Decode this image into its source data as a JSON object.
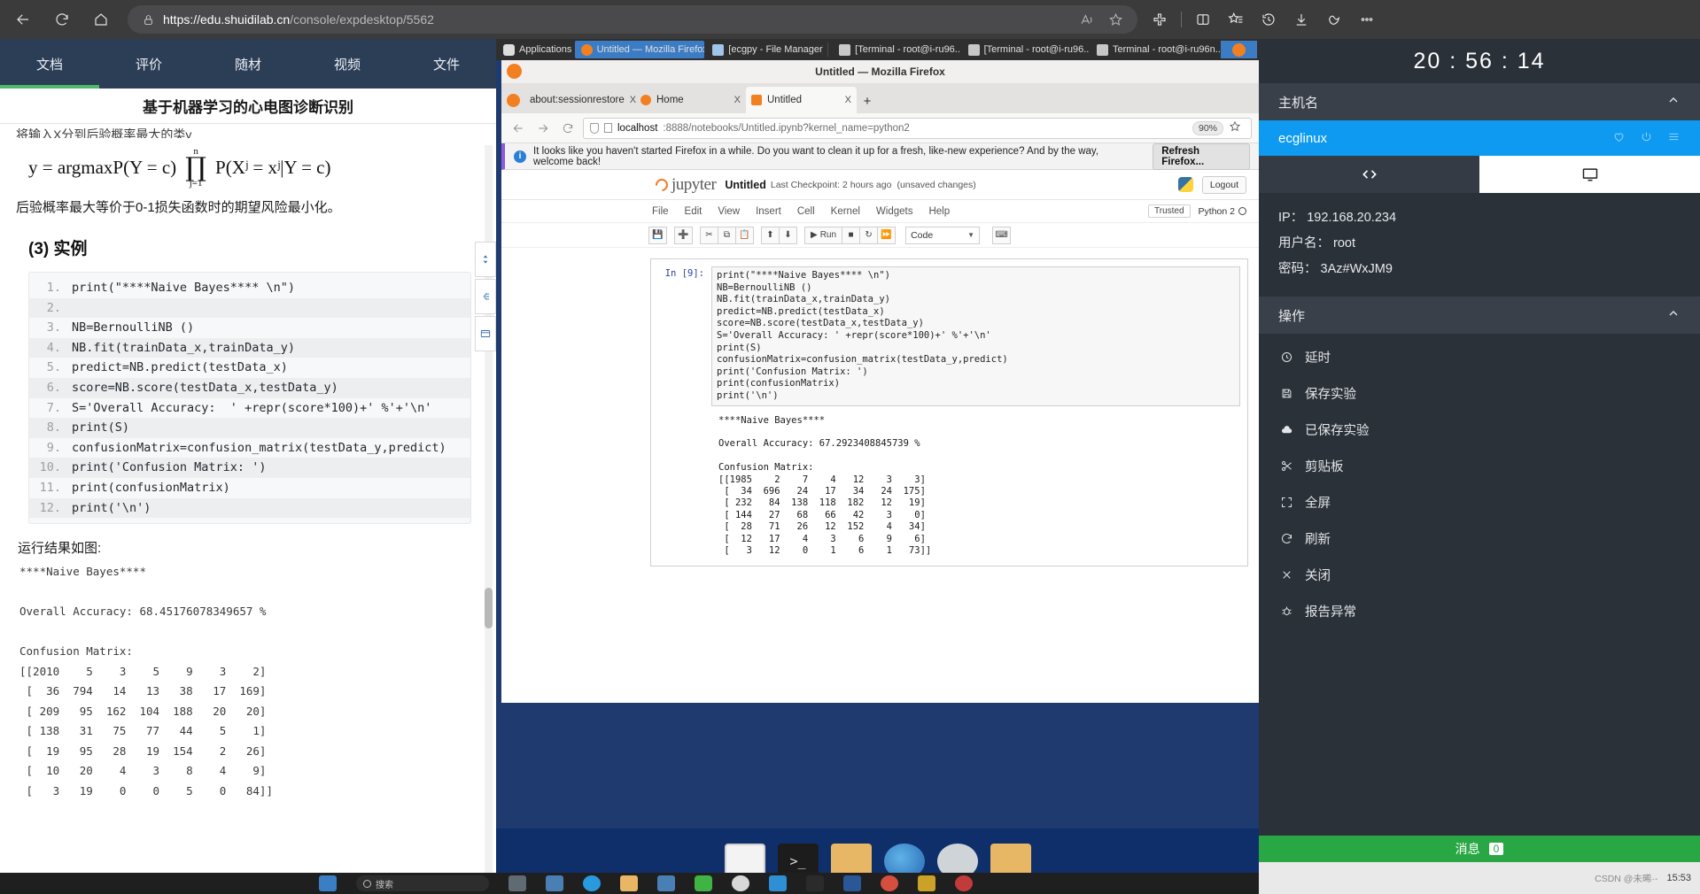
{
  "browser": {
    "url_host": "https://edu.shuidilab.cn",
    "url_path": "/console/expdesktop/5562",
    "nav": {
      "back": "back-arrow",
      "reload": "reload",
      "home": "home"
    },
    "actions": [
      "read-aloud",
      "favorite",
      "extensions",
      "split-screen",
      "collections",
      "history",
      "downloads",
      "copilot",
      "settings-more"
    ]
  },
  "course": {
    "tabs": [
      {
        "label": "文档",
        "active": true
      },
      {
        "label": "评价",
        "active": false
      },
      {
        "label": "随材",
        "active": false
      },
      {
        "label": "视频",
        "active": false
      },
      {
        "label": "文件",
        "active": false
      }
    ],
    "title": "基于机器学习的心电图诊断识别",
    "clipped_line": "将输入X分到后验概率最大的类y",
    "formula": {
      "lhs": "y =  argmaxP(Y = c)",
      "prod_top": "n",
      "prod_bottom": "j=1",
      "rhs": "P(Xʲ = xʲ|Y = c)"
    },
    "sentence": "后验概率最大等价于0-1损失函数时的期望风险最小化。",
    "example_heading": "(3) 实例",
    "code_lines": [
      "print(\"****Naive Bayes**** \\n\")",
      "",
      "NB=BernoulliNB ()",
      "NB.fit(trainData_x,trainData_y)",
      "predict=NB.predict(testData_x)",
      "score=NB.score(testData_x,testData_y)",
      "S='Overall Accuracy:  ' +repr(score*100)+' %'+'\\n'",
      "print(S)",
      "confusionMatrix=confusion_matrix(testData_y,predict)",
      "print('Confusion Matrix: ')",
      "print(confusionMatrix)",
      "print('\\n')"
    ],
    "run_label": "运行结果如图:",
    "output_text": "****Naive Bayes****\n\nOverall Accuracy: 68.45176078349657 %\n\nConfusion Matrix:\n[[2010    5    3    5    9    3    2]\n [  36  794   14   13   38   17  169]\n [ 209   95  162  104  188   20   20]\n [ 138   31   75   77   44    5    1]\n [  19   95   28   19  154    2   26]\n [  10   20    4    3    8    4    9]\n [   3   19    0    0    5    0   84]]"
  },
  "vnc": {
    "taskbar": {
      "applications": "Applications",
      "windows": [
        {
          "label": "Untitled — Mozilla Firefox",
          "icon": "firefox-icon",
          "active": true
        },
        {
          "label": "[ecgpy - File Manager]",
          "icon": "filemanager-icon",
          "active": false
        },
        {
          "label": "[Terminal - root@i-ru96...",
          "icon": "terminal-icon",
          "active": false
        },
        {
          "label": "[Terminal - root@i-ru96...",
          "icon": "terminal-icon",
          "active": false
        },
        {
          "label": "Terminal - root@i-ru96n...",
          "icon": "terminal-icon",
          "active": false
        }
      ]
    },
    "firefox": {
      "window_title": "Untitled — Mozilla Firefox",
      "tabs": [
        {
          "label": "about:sessionrestore",
          "active": false
        },
        {
          "label": "Home",
          "active": false
        },
        {
          "label": "Untitled",
          "active": true
        }
      ],
      "url_host": "localhost",
      "url_rest": ":8888/notebooks/Untitled.ipynb?kernel_name=python2",
      "zoom": "90%",
      "notice": "It looks like you haven't started Firefox in a while. Do you want to clean it up for a fresh, like-new experience? And by the way, welcome back!",
      "notice_button": "Refresh Firefox..."
    },
    "jupyter": {
      "logo": "jupyter",
      "notebook_name": "Untitled",
      "checkpoint": "Last Checkpoint: 2 hours ago",
      "unsaved": "(unsaved changes)",
      "logout": "Logout",
      "menu": [
        "File",
        "Edit",
        "View",
        "Insert",
        "Cell",
        "Kernel",
        "Widgets",
        "Help"
      ],
      "trusted": "Trusted",
      "kernel": "Python 2",
      "toolbar": [
        "save-icon",
        "add-icon",
        "cut-icon",
        "copy-icon",
        "paste-icon",
        "move-up-icon",
        "move-down-icon",
        "run-button",
        "stop-icon",
        "restart-icon",
        "fastforward-icon"
      ],
      "run_label": "Run",
      "cell_type": "Code",
      "prompt": "In [9]:",
      "source": "print(\"****Naive Bayes**** \\n\")\nNB=BernoulliNB ()\nNB.fit(trainData_x,trainData_y)\npredict=NB.predict(testData_x)\nscore=NB.score(testData_x,testData_y)\nS='Overall Accuracy: ' +repr(score*100)+' %'+'\\n'\nprint(S)\nconfusionMatrix=confusion_matrix(testData_y,predict)\nprint('Confusion Matrix: ')\nprint(confusionMatrix)\nprint('\\n')",
      "output": "****Naive Bayes****\n\nOverall Accuracy: 67.2923408845739 %\n\nConfusion Matrix:\n[[1985    2    7    4   12    3    3]\n [  34  696   24   17   34   24  175]\n [ 232   84  138  118  182   12   19]\n [ 144   27   68   66   42    3    0]\n [  28   71   26   12  152    4   34]\n [  12   17    4    3    6    9    6]\n [   3   12    0    1    6    1   73]]"
    },
    "dock": [
      "terminal-icon",
      "console-icon",
      "filemanager-icon",
      "firefox-icon",
      "search-icon",
      "folder-icon"
    ]
  },
  "panel": {
    "clock": "20 : 56 : 14",
    "hostname_section": "主机名",
    "host": "ecglinux",
    "view_tabs": [
      "code-view-icon",
      "desktop-view-icon"
    ],
    "info": [
      {
        "label": "IP：",
        "value": "192.168.20.234"
      },
      {
        "label": "用户名：",
        "value": "root"
      },
      {
        "label": "密码：",
        "value": "3Az#WxJM9"
      }
    ],
    "actions_section": "操作",
    "actions": [
      {
        "label": "延时",
        "icon": "clock-icon"
      },
      {
        "label": "保存实验",
        "icon": "save-icon"
      },
      {
        "label": "已保存实验",
        "icon": "cloud-icon"
      },
      {
        "label": "剪贴板",
        "icon": "scissors-icon"
      },
      {
        "label": "全屏",
        "icon": "fullscreen-icon"
      },
      {
        "label": "刷新",
        "icon": "refresh-icon"
      },
      {
        "label": "关闭",
        "icon": "close-icon"
      },
      {
        "label": "报告异常",
        "icon": "bug-icon"
      }
    ],
    "message_label": "消息",
    "message_count": "0",
    "footer_time": "15:53",
    "footer_watermark": "CSDN @未晞·-"
  },
  "colors": {
    "accent_green": "#4cb96b",
    "header_navy": "#2c3e56",
    "host_blue": "#0d9af0",
    "msg_green": "#29a745",
    "jupyter_orange": "#f37726"
  }
}
